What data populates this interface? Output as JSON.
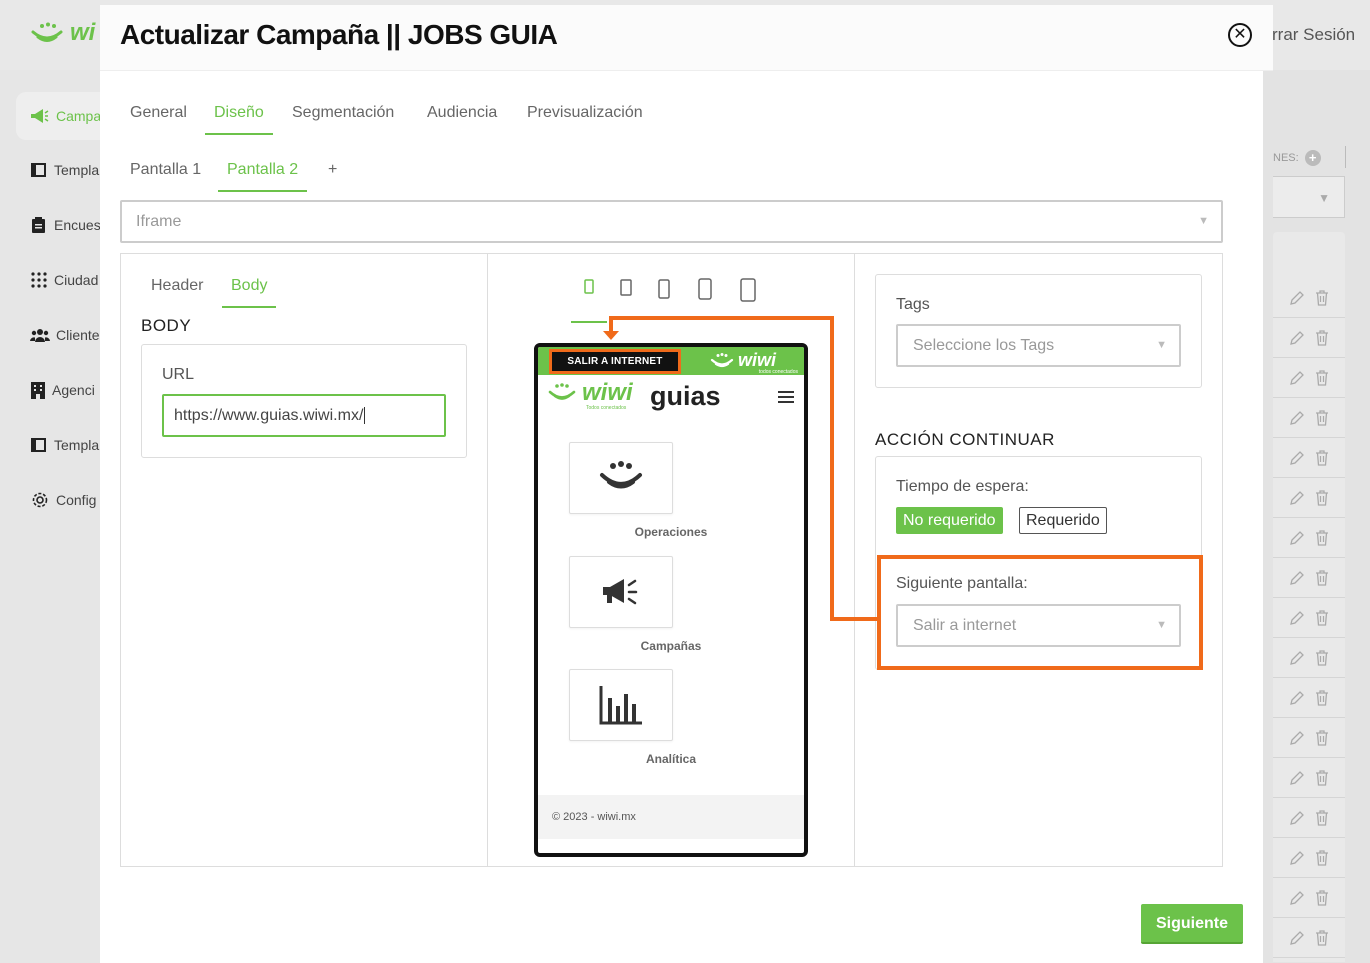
{
  "app": {
    "logo_text": "wi",
    "logout_label": "rrar Sesión",
    "sidebar": [
      {
        "label": "Campa",
        "icon": "megaphone-icon",
        "active": true
      },
      {
        "label": "Templa",
        "icon": "template-icon"
      },
      {
        "label": "Encues",
        "icon": "clipboard-icon"
      },
      {
        "label": "Ciudad",
        "icon": "grid-dots-icon"
      },
      {
        "label": "Cliente",
        "icon": "users-icon"
      },
      {
        "label": "Agenci",
        "icon": "building-icon"
      },
      {
        "label": "Templa",
        "icon": "template-icon"
      },
      {
        "label": "Config",
        "icon": "gear-icon"
      }
    ],
    "right_header": "NES:"
  },
  "modal": {
    "title": "Actualizar Campaña || JOBS GUIA",
    "tabs": [
      {
        "label": "General"
      },
      {
        "label": "Diseño",
        "active": true
      },
      {
        "label": "Segmentación"
      },
      {
        "label": "Audiencia"
      },
      {
        "label": "Previsualización"
      }
    ],
    "screen_tabs": [
      {
        "label": "Pantalla 1"
      },
      {
        "label": "Pantalla 2",
        "active": true
      },
      {
        "label": "+"
      }
    ],
    "type_select": "Iframe",
    "sub_tabs": [
      {
        "label": "Header"
      },
      {
        "label": "Body",
        "active": true
      }
    ],
    "body_heading": "BODY",
    "url_label": "URL",
    "url_value": "https://www.guias.wiwi.mx/",
    "preview": {
      "salir_button": "SALIR A INTERNET",
      "top_logo": "wiwi",
      "top_logo_sub": "todos conectados",
      "brand_logo": "wiwi",
      "brand_sub": "Todos conectados",
      "brand_name": "guias",
      "tiles": [
        {
          "label": "Operaciones",
          "icon": "wifi-smile-icon"
        },
        {
          "label": "Campañas",
          "icon": "megaphone-icon"
        },
        {
          "label": "Analítica",
          "icon": "bar-chart-icon"
        }
      ],
      "footer": "© 2023 - wiwi.mx"
    },
    "tags_label": "Tags",
    "tags_placeholder": "Seleccione los Tags",
    "accion_heading": "ACCIÓN CONTINUAR",
    "tiempo_label": "Tiempo de espera:",
    "no_requerido": "No requerido",
    "requerido": "Requerido",
    "siguiente_pantalla_label": "Siguiente pantalla:",
    "siguiente_pantalla_value": "Salir a internet",
    "next_button": "Siguiente"
  },
  "colors": {
    "accent": "#6cc24a",
    "highlight": "#f06a1a"
  }
}
